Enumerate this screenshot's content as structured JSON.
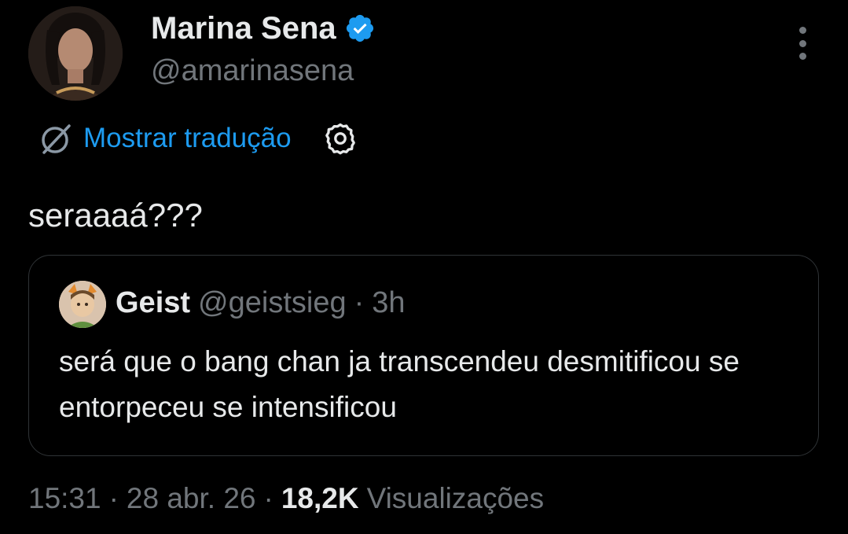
{
  "author": {
    "name": "Marina Sena",
    "handle": "@amarinasena",
    "verified_icon": "verified-badge-icon"
  },
  "translation": {
    "label": "Mostrar tradução",
    "icon": "translate-icon",
    "settings_icon": "gear-icon"
  },
  "tweet": {
    "text": "seraaaá???"
  },
  "quote": {
    "name": "Geist",
    "handle": "@geistsieg",
    "separator": "·",
    "time": "3h",
    "text": "será que o bang chan ja transcendeu desmitificou se entorpeceu se intensificou"
  },
  "meta": {
    "time": "15:31",
    "sep1": "·",
    "date": "28 abr. 26",
    "sep2": "·",
    "views_count": "18,2K",
    "views_label": "Visualizações"
  },
  "colors": {
    "background": "#000000",
    "text_primary": "#e7e9ea",
    "text_secondary": "#71767b",
    "accent": "#1d9bf0",
    "border": "#2f3336"
  }
}
